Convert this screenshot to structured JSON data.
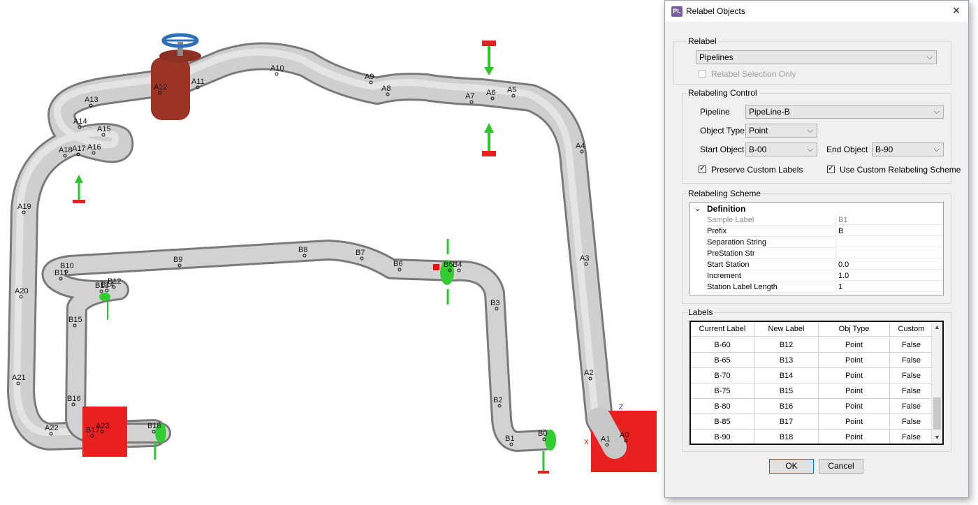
{
  "viewport": {
    "pipe_a_labels": [
      "A0",
      "A1",
      "A2",
      "A3",
      "A4",
      "A5",
      "A6",
      "A7",
      "A8",
      "A9",
      "A10",
      "A11",
      "A12",
      "A13",
      "A14",
      "A15",
      "A16",
      "A17",
      "A18",
      "A19",
      "A20",
      "A21",
      "A22",
      "A23"
    ],
    "pipe_b_labels": [
      "B0",
      "B1",
      "B2",
      "B3",
      "B4",
      "B5",
      "B6",
      "B7",
      "B8",
      "B9",
      "B10",
      "B11",
      "B12",
      "B13",
      "B14",
      "B15",
      "B16",
      "B17",
      "B18"
    ],
    "axis_z": "Z",
    "axis_x": "X",
    "colors": {
      "pipe": "#c9c9c9",
      "flange": "#9b3327",
      "valve_wheel": "#3a78c0",
      "anchor": "#e01818",
      "guide": "#3ad63a"
    }
  },
  "dialog": {
    "app_icon": "PL",
    "title": "Relabel Objects",
    "close_icon": "×",
    "relabel": {
      "group_label": "Relabel",
      "object_select": "Pipelines",
      "selection_only_label": "Relabel Selection Only",
      "selection_only_checked": false
    },
    "control": {
      "group_label": "Relabeling Control",
      "pipeline_label": "Pipeline",
      "pipeline_value": "PipeLine-B",
      "object_type_label": "Object Type",
      "object_type_value": "Point",
      "start_object_label": "Start Object",
      "start_object_value": "B-00",
      "end_object_label": "End Object",
      "end_object_value": "B-90",
      "preserve_label": "Preserve Custom Labels",
      "preserve_checked": true,
      "custom_scheme_label": "Use Custom Relabeling Scheme",
      "custom_scheme_checked": true
    },
    "scheme": {
      "group_label": "Relabeling Scheme",
      "category": "Definition",
      "rows": [
        {
          "name": "Sample Label",
          "value": "B1"
        },
        {
          "name": "Prefix",
          "value": "B"
        },
        {
          "name": "Separation String",
          "value": ""
        },
        {
          "name": "PreStation Str",
          "value": ""
        },
        {
          "name": "Start Station",
          "value": "0.0"
        },
        {
          "name": "Increment",
          "value": "1.0"
        },
        {
          "name": "Station Label Length",
          "value": "1"
        }
      ]
    },
    "labels": {
      "group_label": "Labels",
      "columns": [
        "Current Label",
        "New Label",
        "Obj Type",
        "Custom"
      ],
      "rows": [
        [
          "B-60",
          "B12",
          "Point",
          "False"
        ],
        [
          "B-65",
          "B13",
          "Point",
          "False"
        ],
        [
          "B-70",
          "B14",
          "Point",
          "False"
        ],
        [
          "B-75",
          "B15",
          "Point",
          "False"
        ],
        [
          "B-80",
          "B16",
          "Point",
          "False"
        ],
        [
          "B-85",
          "B17",
          "Point",
          "False"
        ],
        [
          "B-90",
          "B18",
          "Point",
          "False"
        ]
      ]
    },
    "ok_label": "OK",
    "cancel_label": "Cancel"
  }
}
